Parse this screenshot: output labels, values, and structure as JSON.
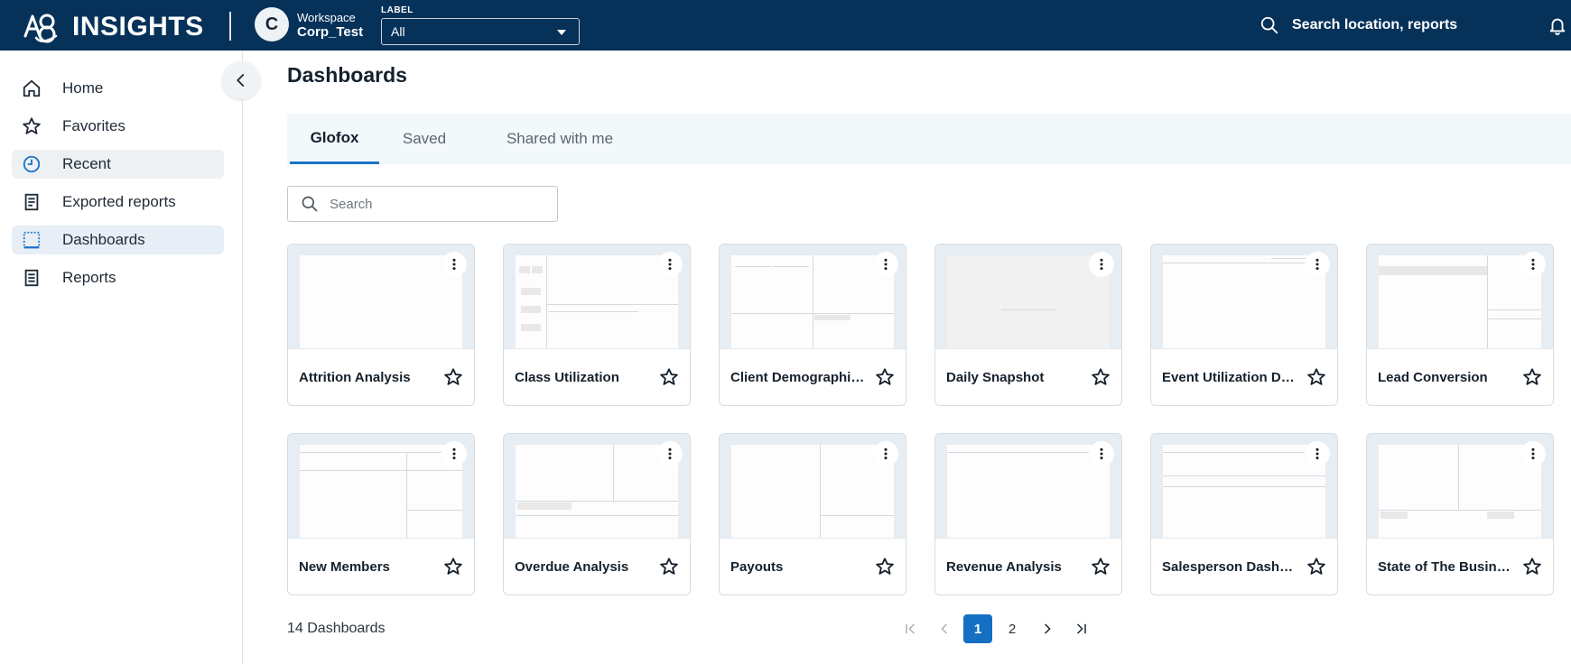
{
  "header": {
    "brand": "INSIGHTS",
    "workspace_avatar": "C",
    "workspace_label": "Workspace",
    "workspace_name": "Corp_Test",
    "label_caption": "LABEL",
    "label_value": "All",
    "search_text": "Search location, reports",
    "icons": {
      "search": "search-icon",
      "notifications": "bell-icon",
      "dropdown": "chevron-down-icon"
    }
  },
  "sidebar": {
    "items": [
      {
        "label": "Home",
        "icon": "home-icon"
      },
      {
        "label": "Favorites",
        "icon": "star-icon"
      },
      {
        "label": "Recent",
        "icon": "clock-icon"
      },
      {
        "label": "Exported reports",
        "icon": "document-icon"
      },
      {
        "label": "Dashboards",
        "icon": "dashboard-icon"
      },
      {
        "label": "Reports",
        "icon": "report-icon"
      }
    ],
    "collapse_icon": "chevron-left-icon"
  },
  "main": {
    "title": "Dashboards",
    "tabs": [
      {
        "label": "Glofox",
        "active": true
      },
      {
        "label": "Saved",
        "active": false
      },
      {
        "label": "Shared with me",
        "active": false
      }
    ],
    "search_placeholder": "Search",
    "cards": [
      {
        "name": "Attrition Analysis"
      },
      {
        "name": "Class Utilization"
      },
      {
        "name": "Client Demographics"
      },
      {
        "name": "Daily Snapshot"
      },
      {
        "name": "Event Utilization Dashboard"
      },
      {
        "name": "Lead Conversion"
      },
      {
        "name": "New Members"
      },
      {
        "name": "Overdue Analysis"
      },
      {
        "name": "Payouts"
      },
      {
        "name": "Revenue Analysis"
      },
      {
        "name": "Salesperson Dashboard"
      },
      {
        "name": "State of The Business"
      }
    ],
    "card_icons": {
      "menu": "more-vertical-icon",
      "favorite": "star-outline-icon"
    },
    "count_text": "14 Dashboards",
    "pagination": {
      "pages": [
        "1",
        "2"
      ],
      "current_page": "1",
      "icons": {
        "first": "first-page-icon",
        "prev": "chevron-left-icon",
        "next": "chevron-right-icon",
        "last": "last-page-icon"
      }
    }
  },
  "colors": {
    "header_bg": "#06325a",
    "accent": "#1570c4",
    "tab_bar_bg": "#f3f8fb"
  }
}
